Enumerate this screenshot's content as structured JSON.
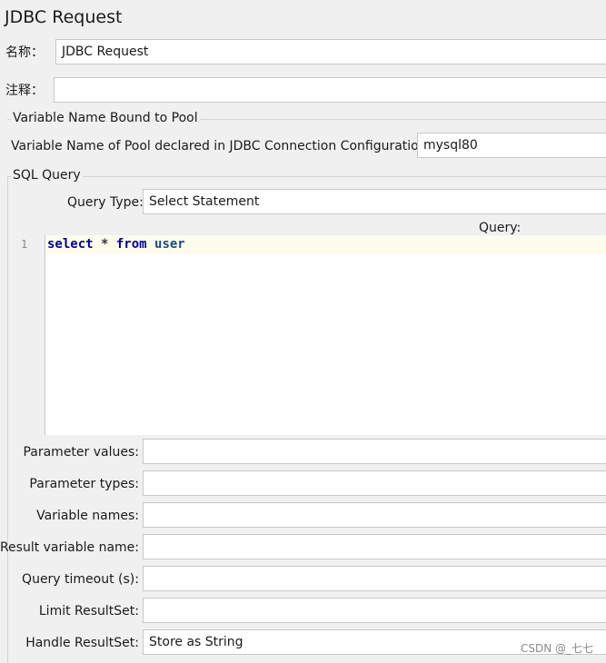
{
  "panel": {
    "title": "JDBC Request"
  },
  "name": {
    "label": "名称：",
    "value": "JDBC Request"
  },
  "comments": {
    "label": "注释：",
    "value": ""
  },
  "pool_group": {
    "title": "Variable Name Bound to Pool",
    "pool_label": "Variable Name of Pool declared in JDBC Connection Configuration:",
    "pool_value": "mysql80"
  },
  "sql_group": {
    "title": "SQL Query",
    "query_type_label": "Query Type:",
    "query_type_value": "Select Statement",
    "query_label": "Query:",
    "line_number": "1",
    "code": {
      "kw1": "select",
      "op": " * ",
      "kw2": "from",
      "id": " user"
    }
  },
  "params": {
    "parameter_values": {
      "label": "Parameter values:",
      "value": ""
    },
    "parameter_types": {
      "label": "Parameter types:",
      "value": ""
    },
    "variable_names": {
      "label": "Variable names:",
      "value": ""
    },
    "result_variable_name": {
      "label": "Result variable name:",
      "value": ""
    },
    "query_timeout": {
      "label": "Query timeout (s):",
      "value": ""
    },
    "limit_resultset": {
      "label": "Limit ResultSet:",
      "value": ""
    },
    "handle_resultset": {
      "label": "Handle ResultSet:",
      "value": "Store as String"
    }
  },
  "watermark": "CSDN @_七七"
}
